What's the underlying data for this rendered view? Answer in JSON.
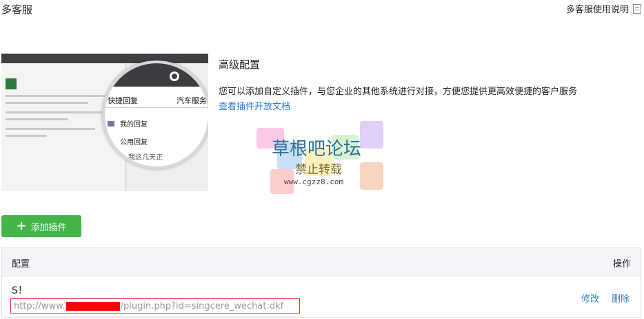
{
  "header": {
    "title": "多客服",
    "help_label": "多客服使用说明"
  },
  "preview": {
    "tab_quick_reply": "快捷回复",
    "tab_car_service": "汽车服务",
    "item_my_replies": "我的回复",
    "item_public_replies": "公用回复",
    "item_snippet": "您，我这几天正"
  },
  "advanced": {
    "title": "高级配置",
    "description": "您可以添加自定义插件，与您企业的其他系统进行对接，方便您提供更高效便捷的客户服务",
    "doc_link": "查看插件开放文档"
  },
  "watermark": {
    "line1": "草根吧论坛",
    "line2": "禁止转载",
    "line3": "www.cgzz8.com"
  },
  "add_button": {
    "label": "添加插件"
  },
  "table": {
    "header_config": "配置",
    "header_ops": "操作",
    "rows": [
      {
        "name": "S！",
        "url_prefix": "http://www.",
        "url_suffix": "/plugin.php?id=singcere_wechat:dkf",
        "edit": "修改",
        "delete": "删除"
      }
    ]
  },
  "colors": {
    "accent_green": "#44b549",
    "link_blue": "#2d7cc9",
    "highlight_red": "#dd3333"
  }
}
